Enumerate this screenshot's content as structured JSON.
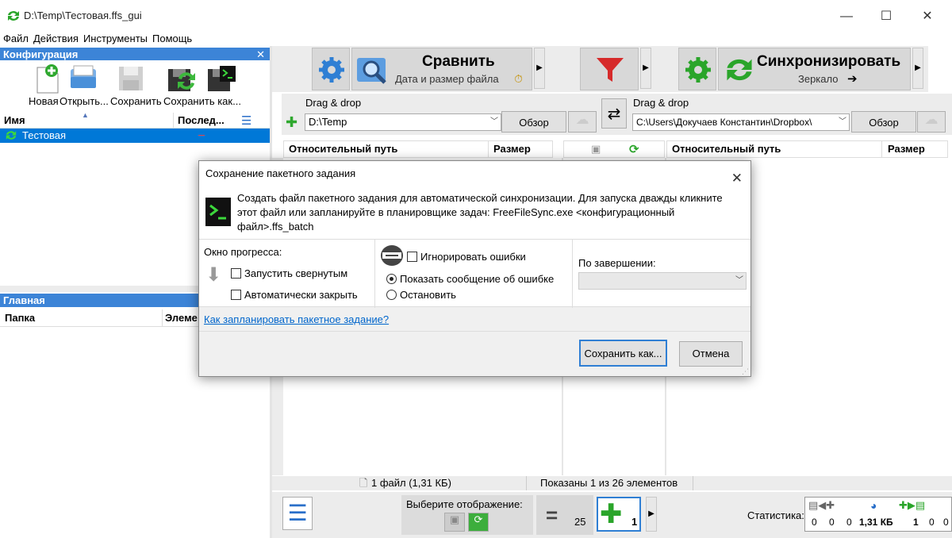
{
  "window": {
    "title": "D:\\Temp\\Тестовая.ffs_gui"
  },
  "menu": [
    "Файл",
    "Действия",
    "Инструменты",
    "Помощь"
  ],
  "config_panel": {
    "header": "Конфигурация",
    "tools": [
      "Новая",
      "Открыть...",
      "Сохранить",
      "Сохранить как..."
    ],
    "col_name": "Имя",
    "col_last": "Послед...",
    "row": "Тестовая"
  },
  "main_panel": {
    "header": "Главная",
    "col_folder": "Папка",
    "col_elements": "Элеме"
  },
  "compare": {
    "title": "Сравнить",
    "subtitle": "Дата и размер файла"
  },
  "sync": {
    "title": "Синхронизировать",
    "subtitle": "Зеркало"
  },
  "left_folder": {
    "drag": "Drag & drop",
    "path": "D:\\Temp",
    "browse": "Обзор"
  },
  "right_folder": {
    "drag": "Drag & drop",
    "path": "C:\\Users\\Докучаев Константин\\Dropbox\\",
    "browse": "Обзор"
  },
  "grid": {
    "rel_path": "Относительный путь",
    "size": "Размер"
  },
  "status": {
    "files": "1 файл (1,31 КБ)",
    "shown": "Показаны 1 из 26 элементов"
  },
  "bottom": {
    "view_label": "Выберите отображение:",
    "equal_count": "25",
    "create_count": "1",
    "stats_label": "Статистика:",
    "stats": [
      "0",
      "0",
      "0",
      "1,31 КБ",
      "1",
      "0",
      "0"
    ]
  },
  "dialog": {
    "title": "Сохранение пакетного задания",
    "info": "Создать файл пакетного задания для автоматической синхронизации. Для запуска дважды кликните этот файл или запланируйте в планировщике задач: FreeFileSync.exe <конфигурационный файл>.ffs_batch",
    "progress_label": "Окно прогресса:",
    "run_minimized": "Запустить свернутым",
    "auto_close": "Автоматически закрыть",
    "ignore_errors": "Игнорировать ошибки",
    "show_error": "Показать сообщение об ошибке",
    "stop": "Остановить",
    "on_complete": "По завершении:",
    "schedule_link": "Как запланировать пакетное задание?",
    "save_as": "Сохранить как...",
    "cancel": "Отмена"
  },
  "colors": {
    "accent": "#3c84d7",
    "selection": "#0078d7",
    "link": "#0066cc"
  }
}
